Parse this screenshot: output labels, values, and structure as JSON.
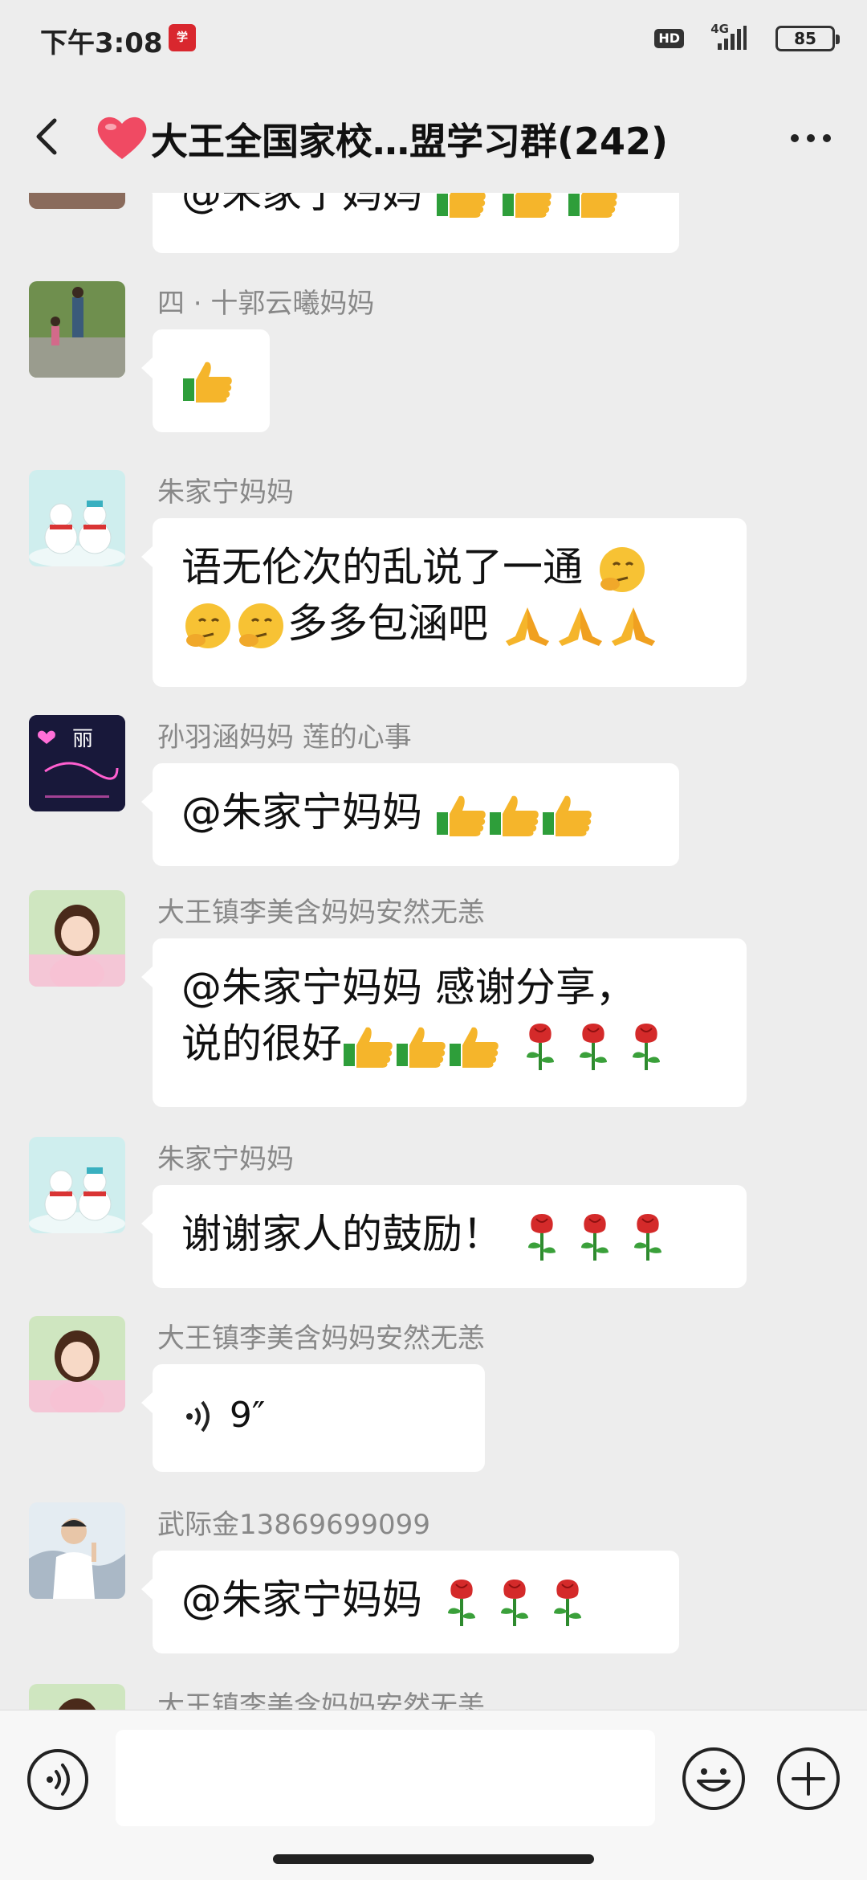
{
  "status_bar": {
    "time": "下午3:08",
    "hd": "HD",
    "network": "4G",
    "battery": "85"
  },
  "header": {
    "title": "大王全国家校…盟学习群(242)"
  },
  "colors": {
    "background": "#ededed",
    "bubble": "#ffffff",
    "sender_text": "#888888",
    "accent_thumb": "#f5b52b",
    "rose_red": "#d42a2a"
  },
  "messages": [
    {
      "sender": "",
      "text": "@朱家宁妈妈 ",
      "emoji": [
        "thumbs-up",
        "thumbs-up",
        "thumbs-up"
      ],
      "avatar": "avatar-partial"
    },
    {
      "sender": "四 · 十郭云曦妈妈",
      "text": "",
      "emoji": [
        "thumbs-up"
      ],
      "avatar": "avatar-family-photo"
    },
    {
      "sender": "朱家宁妈妈",
      "line1": "语无伦次的乱说了一通",
      "line2": "多多包涵吧",
      "emoji_line1": [
        "thinking"
      ],
      "emoji_line2_pre": [
        "thinking",
        "thinking"
      ],
      "emoji_line2_post": [
        "pray",
        "pray",
        "pray"
      ],
      "avatar": "avatar-snowmen"
    },
    {
      "sender": "孙羽涵妈妈 莲的心事",
      "text": "@朱家宁妈妈 ",
      "emoji": [
        "thumbs-up",
        "thumbs-up",
        "thumbs-up"
      ],
      "avatar": "avatar-neon",
      "avatar_text": "丽"
    },
    {
      "sender": "大王镇李美含妈妈安然无恙",
      "line1": "@朱家宁妈妈  感谢分享，",
      "line2": "说的很好",
      "emoji": [
        "thumbs-up",
        "thumbs-up",
        "thumbs-up",
        "rose",
        "rose",
        "rose"
      ],
      "avatar": "avatar-girl"
    },
    {
      "sender": "朱家宁妈妈",
      "text": "谢谢家人的鼓励！",
      "emoji": [
        "rose",
        "rose",
        "rose"
      ],
      "avatar": "avatar-snowmen"
    },
    {
      "sender": "大王镇李美含妈妈安然无恙",
      "voice_duration": "9″",
      "avatar": "avatar-girl"
    },
    {
      "sender": "武际金13869699099",
      "text": "@朱家宁妈妈 ",
      "emoji": [
        "rose",
        "rose",
        "rose"
      ],
      "avatar": "avatar-man"
    },
    {
      "sender": "大王镇李美含妈妈安然无恙",
      "avatar": "avatar-girl"
    }
  ],
  "input": {
    "placeholder": ""
  }
}
